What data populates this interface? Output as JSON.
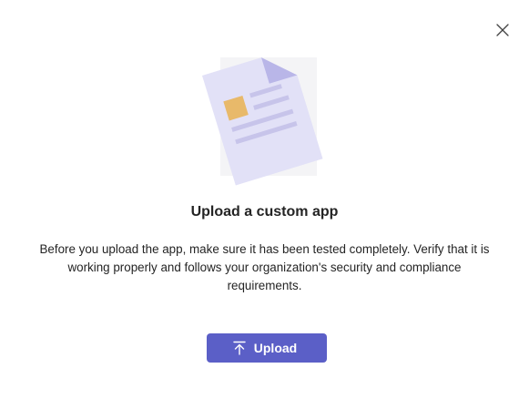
{
  "dialog": {
    "title": "Upload a custom app",
    "description": "Before you upload the app, make sure it has been tested completely. Verify that it is working properly and follows your organization's security and compliance requirements.",
    "upload_button_label": "Upload",
    "close_icon": "close-icon",
    "upload_icon": "upload-arrow-icon",
    "illustration_icon": "document-icon"
  },
  "colors": {
    "accent": "#5b5fc7",
    "document_page": "#e2e1f7",
    "document_fold": "#b9b6e8",
    "document_lines": "#c7c4ea",
    "document_block": "#e8b96a",
    "background_page": "#f4f4f6"
  }
}
